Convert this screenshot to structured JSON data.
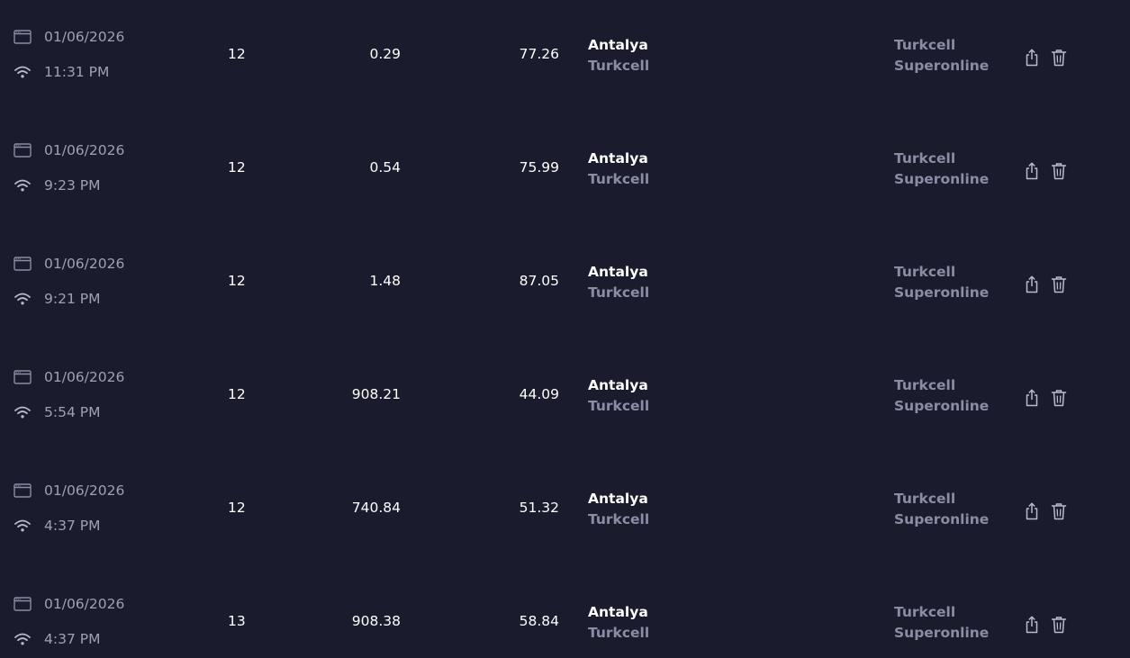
{
  "results": [
    {
      "date": "01/06/2026",
      "time": "11:31 PM",
      "ping": "12",
      "download": "0.29",
      "upload": "77.26",
      "server_city": "Antalya",
      "server_sponsor": "Turkcell",
      "provider_line1": "Turkcell",
      "provider_line2": "Superonline"
    },
    {
      "date": "01/06/2026",
      "time": "9:23 PM",
      "ping": "12",
      "download": "0.54",
      "upload": "75.99",
      "server_city": "Antalya",
      "server_sponsor": "Turkcell",
      "provider_line1": "Turkcell",
      "provider_line2": "Superonline"
    },
    {
      "date": "01/06/2026",
      "time": "9:21 PM",
      "ping": "12",
      "download": "1.48",
      "upload": "87.05",
      "server_city": "Antalya",
      "server_sponsor": "Turkcell",
      "provider_line1": "Turkcell",
      "provider_line2": "Superonline"
    },
    {
      "date": "01/06/2026",
      "time": "5:54 PM",
      "ping": "12",
      "download": "908.21",
      "upload": "44.09",
      "server_city": "Antalya",
      "server_sponsor": "Turkcell",
      "provider_line1": "Turkcell",
      "provider_line2": "Superonline"
    },
    {
      "date": "01/06/2026",
      "time": "4:37 PM",
      "ping": "12",
      "download": "740.84",
      "upload": "51.32",
      "server_city": "Antalya",
      "server_sponsor": "Turkcell",
      "provider_line1": "Turkcell",
      "provider_line2": "Superonline"
    },
    {
      "date": "01/06/2026",
      "time": "4:37 PM",
      "ping": "13",
      "download": "908.38",
      "upload": "58.84",
      "server_city": "Antalya",
      "server_sponsor": "Turkcell",
      "provider_line1": "Turkcell",
      "provider_line2": "Superonline"
    }
  ],
  "icons": {
    "device": "browser-window-icon",
    "connection": "wifi-icon",
    "share": "share-icon",
    "delete": "trash-icon"
  },
  "colors": {
    "background": "#1a1c2e",
    "primary_text": "#ffffff",
    "secondary_text": "#9ea1b4",
    "muted_bold_text": "#8a8da3"
  }
}
